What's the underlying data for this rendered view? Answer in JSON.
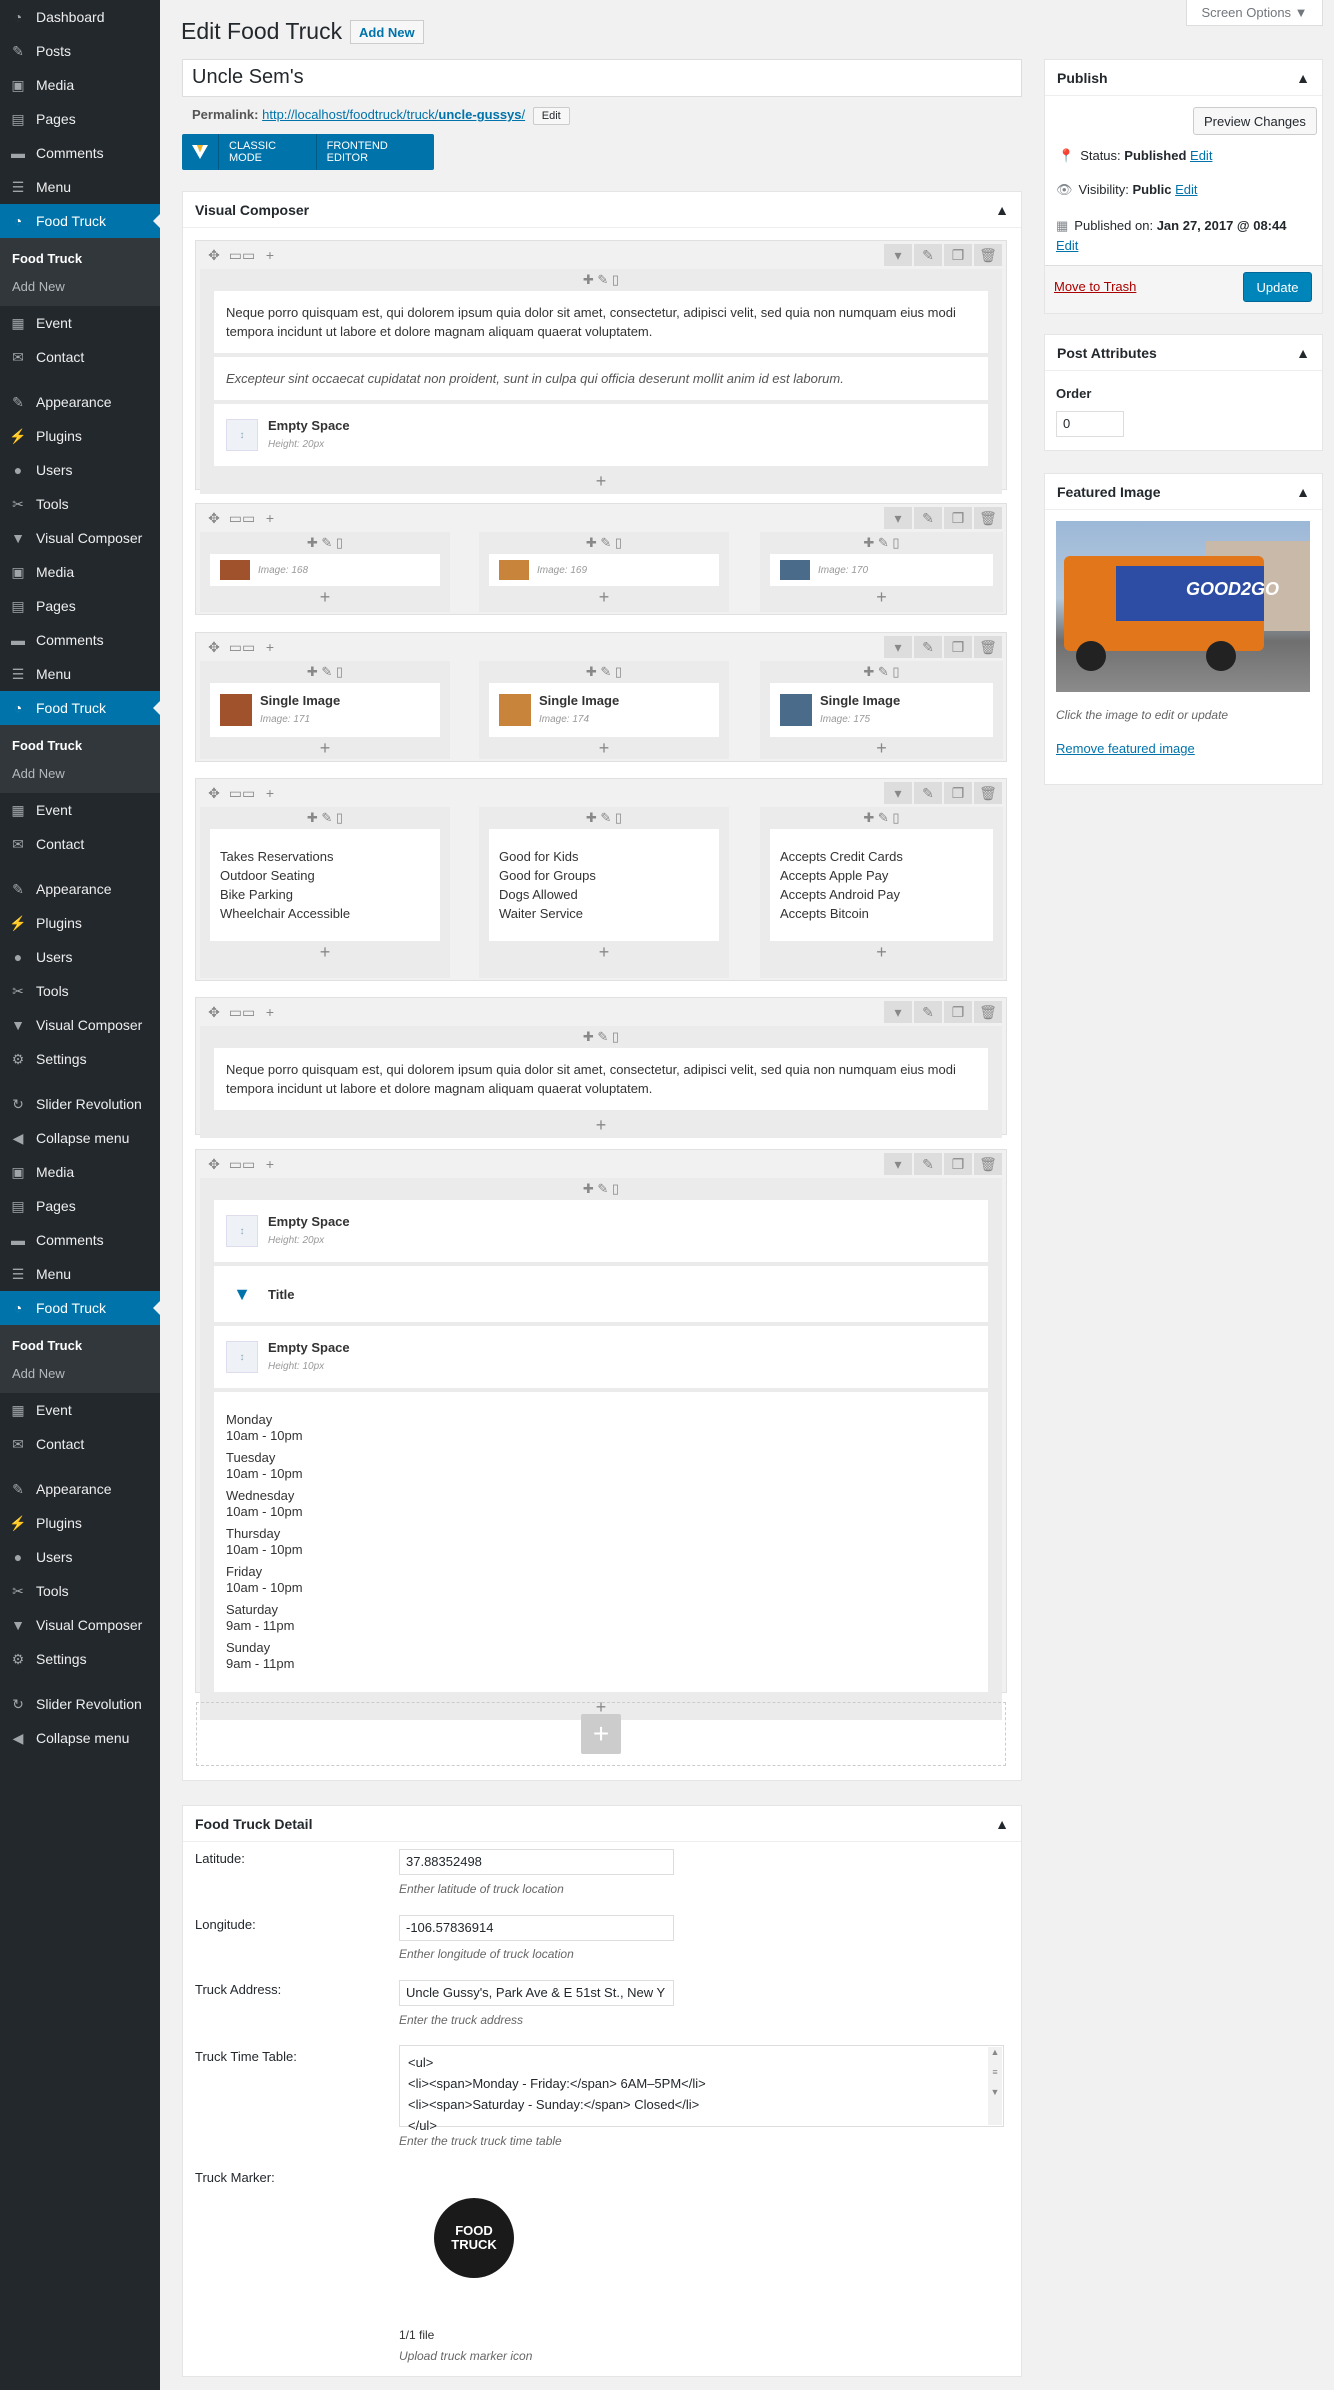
{
  "sidebar": {
    "groups": [
      {
        "items": [
          "Dashboard",
          "Posts",
          "Media",
          "Pages",
          "Comments",
          "Menu"
        ],
        "current": "Food Truck",
        "sub_current": "Food Truck",
        "sub_add": "Add New",
        "after": [
          "Event",
          "Contact"
        ],
        "after2": [
          "Appearance",
          "Plugins",
          "Users",
          "Tools",
          "Visual Composer"
        ]
      },
      {
        "items": [
          "Media",
          "Pages",
          "Comments",
          "Menu"
        ],
        "current": "Food Truck",
        "sub_current": "Food Truck",
        "sub_add": "Add New",
        "after": [
          "Event",
          "Contact"
        ],
        "after2": [
          "Appearance",
          "Plugins",
          "Users",
          "Tools",
          "Visual Composer",
          "Settings"
        ],
        "after3": [
          "Slider Revolution",
          "Collapse menu"
        ]
      },
      {
        "items": [
          "Media",
          "Pages",
          "Comments",
          "Menu"
        ],
        "current": "Food Truck",
        "sub_current": "Food Truck",
        "sub_add": "Add New",
        "after": [
          "Event",
          "Contact"
        ],
        "after2": [
          "Appearance",
          "Plugins",
          "Users",
          "Tools",
          "Visual Composer",
          "Settings"
        ],
        "after3": [
          "Slider Revolution",
          "Collapse menu"
        ]
      }
    ]
  },
  "screen_options": "Screen Options ▼",
  "title": "Edit Food Truck",
  "add_new": "Add New",
  "post_title": "Uncle Sem's",
  "permalink": {
    "label": "Permalink:",
    "url": "http://localhost/foodtruck/truck/",
    "slug": "uncle-gussys",
    "suffix": "/",
    "edit": "Edit"
  },
  "vc_modes": {
    "classic": "CLASSIC MODE",
    "frontend": "FRONTEND EDITOR"
  },
  "vc": {
    "title": "Visual Composer",
    "text1": "Neque porro quisquam est, qui dolorem ipsum quia dolor sit amet, consectetur, adipisci velit, sed quia non numquam eius modi tempora incidunt ut labore et dolore magnam aliquam quaerat voluptatem.",
    "text2": "Excepteur sint occaecat cupidatat non proident, sunt in culpa qui officia deserunt mollit anim id est laborum.",
    "empty_space": "Empty Space",
    "height20": "Height: 20px",
    "height10": "Height: 10px",
    "images": [
      "Image: 168",
      "Image: 169",
      "Image: 170"
    ],
    "single_image": "Single Image",
    "single_ids": [
      "Image: 171",
      "Image: 174",
      "Image: 175"
    ],
    "col1": [
      "Takes Reservations",
      "Outdoor Seating",
      "Bike Parking",
      "Wheelchair Accessible"
    ],
    "col2": [
      "Good for Kids",
      "Good for Groups",
      "Dogs Allowed",
      "Waiter Service"
    ],
    "col3": [
      "Accepts Credit Cards",
      "Accepts Apple Pay",
      "Accepts Android Pay",
      "Accepts Bitcoin"
    ],
    "title_el": "Title",
    "hours": [
      [
        "Monday",
        "10am - 10pm"
      ],
      [
        "Tuesday",
        "10am - 10pm"
      ],
      [
        "Wednesday",
        "10am - 10pm"
      ],
      [
        "Thursday",
        "10am - 10pm"
      ],
      [
        "Friday",
        "10am - 10pm"
      ],
      [
        "Saturday",
        "9am - 11pm"
      ],
      [
        "Sunday",
        "9am - 11pm"
      ]
    ]
  },
  "detail": {
    "title": "Food Truck Detail",
    "lat_label": "Latitude:",
    "lat": "37.88352498",
    "lat_desc": "Enther latitude of truck location",
    "lon_label": "Longitude:",
    "lon": "-106.57836914",
    "lon_desc": "Enther longitude of truck location",
    "addr_label": "Truck Address:",
    "addr": "Uncle Gussy's, Park Ave & E 51st St., New Y",
    "addr_desc": "Enter the truck address",
    "tt_label": "Truck Time Table:",
    "tt_lines": [
      "<ul>",
      "<li><span>Monday - Friday:</span> 6AM–5PM</li>",
      "<li><span>Saturday - Sunday:</span> Closed</li>",
      "</ul>"
    ],
    "tt_desc": "Enter the truck truck time table",
    "marker_label": "Truck Marker:",
    "marker_text": "FOOD TRUCK",
    "marker_count": "1/1 file",
    "marker_desc": "Upload truck marker icon"
  },
  "publish": {
    "title": "Publish",
    "preview": "Preview Changes",
    "status_l": "Status:",
    "status": "Published",
    "vis_l": "Visibility:",
    "vis": "Public",
    "pub_l": "Published on:",
    "pub": "Jan 27, 2017 @ 08:44",
    "edit": "Edit",
    "trash": "Move to Trash",
    "update": "Update"
  },
  "attrs": {
    "title": "Post Attributes",
    "order_l": "Order",
    "order": "0"
  },
  "featured": {
    "title": "Featured Image",
    "brand": "GOOD2GO",
    "hint": "Click the image to edit or update",
    "remove": "Remove featured image"
  }
}
